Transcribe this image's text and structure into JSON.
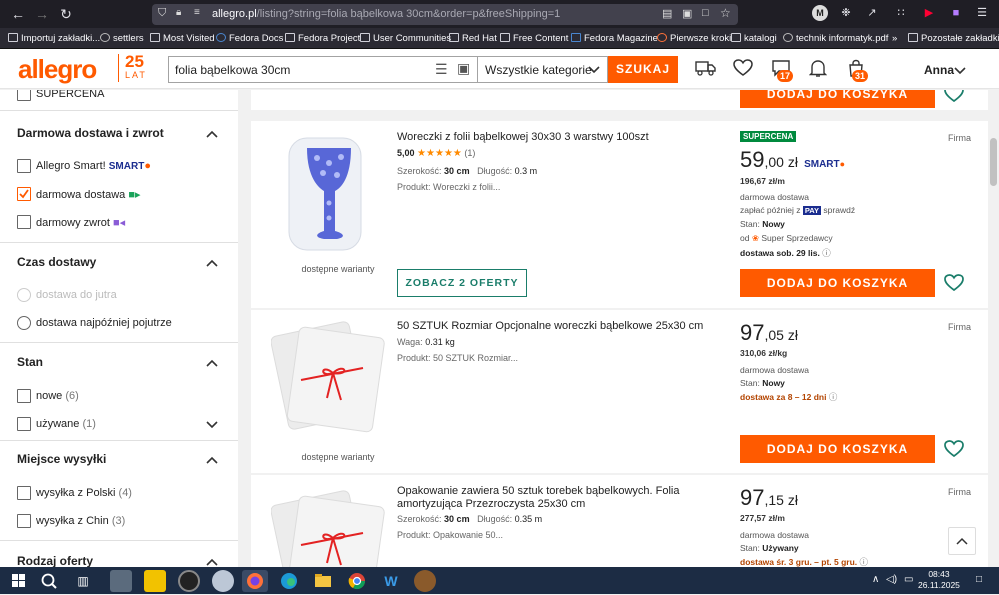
{
  "browser": {
    "url_host": "allegro.pl",
    "url_rest": "/listing?string=folia bąbelkowa 30cm&order=p&freeShipping=1",
    "bookmarks": [
      "Importuj zakładki...",
      "settlers",
      "Most Visited",
      "Fedora Docs",
      "Fedora Project",
      "User Communities",
      "Red Hat",
      "Free Content",
      "Fedora Magazine",
      "Pierwsze kroki",
      "katalogi",
      "technik informatyk.pdf",
      "Pozostałe zakładki"
    ]
  },
  "header": {
    "logo": "allegro",
    "logo_badge_number": "25",
    "logo_badge_text": "LAT",
    "search_query": "folia bąbelkowa 30cm",
    "category": "Wszystkie kategorie",
    "search_button": "SZUKAJ",
    "notifications_badge": "17",
    "cart_badge": "31",
    "user": "Anna"
  },
  "sidebar": {
    "supercena_label": "SUPERCENA",
    "delivery_title": "Darmowa dostawa i zwrot",
    "smart_label": "Allegro Smart!",
    "smart_brand": "SMART",
    "free_delivery_label": "darmowa dostawa",
    "free_return_label": "darmowy zwrot",
    "time_title": "Czas dostawy",
    "by_tomorrow": "dostawa do jutra",
    "day_after": "dostawa najpóźniej pojutrze",
    "condition_title": "Stan",
    "new_label": "nowe",
    "new_count": "(6)",
    "used_label": "używane",
    "used_count": "(1)",
    "location_title": "Miejsce wysyłki",
    "poland_label": "wysyłka z Polski",
    "poland_count": "(4)",
    "china_label": "wysyłka z Chin",
    "china_count": "(3)",
    "offer_type_title": "Rodzaj oferty"
  },
  "cards": {
    "top_cart": "DODAJ DO KOSZYKA",
    "c1": {
      "title": "Woreczki z folii bąbelkowej 30x30 3 warstwy 100szt",
      "rating": "5,00",
      "stars": "★★★★★",
      "rating_count": "(1)",
      "width_label": "Szerokość:",
      "width": "30 cm",
      "length_label": "Długość:",
      "length": "0.3 m",
      "product": "Produkt: Woreczki z folii...",
      "variants": "dostępne warianty",
      "offers_button": "ZOBACZ 2 OFERTY",
      "supercena": "SUPERCENA",
      "seller_type": "Firma",
      "price_int": "59",
      "price_dec": ",00 zł",
      "smart": "SMART",
      "unit_price": "196,67 zł/m",
      "delivery": "darmowa dostawa",
      "pay_later_a": "zapłać później z",
      "pay_badge": "PAY",
      "pay_later_b": "sprawdź",
      "condition_label": "Stan:",
      "condition": "Nowy",
      "seller_prefix": "od",
      "seller": "Super Sprzedawcy",
      "delivery_date": "dostawa sob. 29 lis.",
      "cart": "DODAJ DO KOSZYKA"
    },
    "c2": {
      "title": "50 SZTUK Rozmiar Opcjonalne woreczki bąbelkowe 25x30 cm",
      "weight_label": "Waga:",
      "weight": "0.31 kg",
      "product": "Produkt: 50 SZTUK Rozmiar...",
      "variants": "dostępne warianty",
      "seller_type": "Firma",
      "price_int": "97",
      "price_dec": ",05 zł",
      "unit_price": "310,06 zł/kg",
      "delivery": "darmowa dostawa",
      "condition_label": "Stan:",
      "condition": "Nowy",
      "delivery_date": "dostawa za 8 – 12 dni",
      "cart": "DODAJ DO KOSZYKA"
    },
    "c3": {
      "title": "Opakowanie zawiera 50 sztuk torebek bąbelkowych. Folia amortyzująca Przezroczysta 25x30 cm",
      "width_label": "Szerokość:",
      "width": "30 cm",
      "length_label": "Długość:",
      "length": "0.35 m",
      "product": "Produkt: Opakowanie 50...",
      "seller_type": "Firma",
      "price_int": "97",
      "price_dec": ",15 zł",
      "unit_price": "277,57 zł/m",
      "delivery": "darmowa dostawa",
      "condition_label": "Stan:",
      "condition": "Używany",
      "delivery_date": "dostawa śr. 3 gru. – pt. 5 gru."
    }
  },
  "taskbar": {
    "time": "08:43",
    "date": "26.11.2025"
  },
  "colors": {
    "brand": "#ff5a00",
    "teal": "#1a7d6a",
    "green": "#008a3e"
  }
}
